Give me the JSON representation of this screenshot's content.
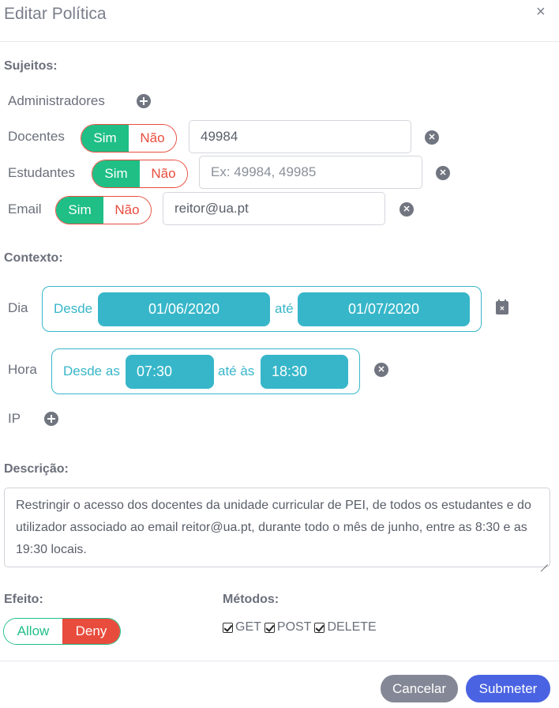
{
  "modal": {
    "title": "Editar Política",
    "close": "×"
  },
  "subjects": {
    "heading": "Sujeitos:",
    "administradores": {
      "label": "Administradores"
    },
    "docentes": {
      "label": "Docentes",
      "sim": "Sim",
      "nao": "Não",
      "value": "49984"
    },
    "estudantes": {
      "label": "Estudantes",
      "sim": "Sim",
      "nao": "Não",
      "placeholder": "Ex: 49984, 49985"
    },
    "email": {
      "label": "Email",
      "sim": "Sim",
      "nao": "Não",
      "value": "reitor@ua.pt"
    }
  },
  "context": {
    "heading": "Contexto:",
    "dia": {
      "label": "Dia",
      "from_label": "Desde",
      "from": "01/06/2020",
      "to_label": "até",
      "to": "01/07/2020"
    },
    "hora": {
      "label": "Hora",
      "from_label": "Desde as",
      "from": "07:30",
      "to_label": "até às",
      "to": "18:30"
    },
    "ip": {
      "label": "IP"
    }
  },
  "description": {
    "heading": "Descrição:",
    "text": "Restringir o acesso dos docentes da unidade curricular de PEI, de todos os estudantes e do utilizador associado ao email reitor@ua.pt, durante todo o mês de junho, entre as 8:30 e as 19:30 locais."
  },
  "effect": {
    "heading": "Efeito:",
    "allow": "Allow",
    "deny": "Deny",
    "selected": "Deny"
  },
  "methods": {
    "heading": "Métodos:",
    "items": [
      "GET",
      "POST",
      "DELETE"
    ]
  },
  "footer": {
    "cancel": "Cancelar",
    "submit": "Submeter"
  },
  "colors": {
    "accent": "#37b6c9",
    "success": "#1fbf86",
    "danger": "#e84c3d",
    "primary": "#4a63e2",
    "secondary": "#848896"
  },
  "icons": [
    "close-icon",
    "plus-circle-icon",
    "x-circle-icon",
    "calendar-x-icon",
    "checkbox-checked-icon"
  ]
}
